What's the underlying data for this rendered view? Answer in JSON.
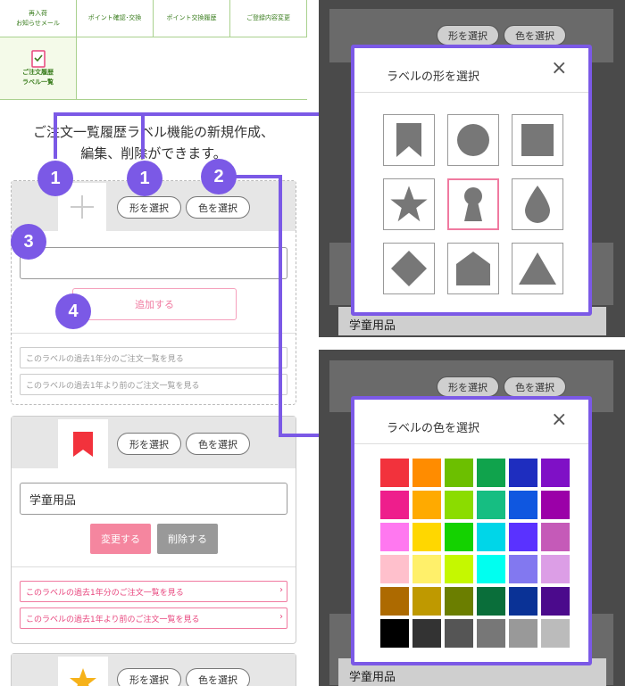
{
  "nav": {
    "top_left_line1": "再入荷",
    "top_left_line2": "お知らせメール",
    "top_cell2": "ポイント確認･交換",
    "top_cell3": "ポイント交換履歴",
    "top_cell4": "ご登録内容変更",
    "active_line1": "ご注文履歴",
    "active_line2": "ラベル一覧"
  },
  "intro": {
    "line1": "ご注文一覧履歴ラベル機能の新規作成、",
    "line2": "編集、削除ができます。"
  },
  "steps": [
    "1",
    "1",
    "2",
    "3",
    "4"
  ],
  "new_card": {
    "shape_btn": "形を選択",
    "color_btn": "色を選択",
    "add_btn": "追加する",
    "link1": "このラベルの過去1年分のご注文一覧を見る",
    "link2": "このラベルの過去1年より前のご注文一覧を見る"
  },
  "label_card": {
    "shape_btn": "形を選択",
    "color_btn": "色を選択",
    "name": "学童用品",
    "change_btn": "変更する",
    "delete_btn": "削除する",
    "link1": "このラベルの過去1年分のご注文一覧を見る",
    "link2": "このラベルの過去1年より前のご注文一覧を見る",
    "chevron": "›"
  },
  "third_card": {
    "shape_btn": "形を選択",
    "color_btn": "色を選択"
  },
  "shape_modal": {
    "title": "ラベルの形を選択",
    "close": "×",
    "bg_btn1": "形を選択",
    "bg_btn2": "色を選択",
    "bg_text": "学童用品",
    "shapes": [
      "bookmark-icon",
      "circle-icon",
      "square-icon",
      "star-icon",
      "keyhole-icon",
      "drop-icon",
      "diamond-icon",
      "house-icon",
      "triangle-icon"
    ],
    "selected_index": 4
  },
  "color_modal": {
    "title": "ラベルの色を選択",
    "close": "×",
    "bg_btn1": "形を選択",
    "bg_btn2": "色を選択",
    "bg_text": "学童用品",
    "colors": [
      "#f2323c",
      "#ff8c00",
      "#6cbf00",
      "#10a34c",
      "#1e2dbf",
      "#7f10c6",
      "#ee1e8c",
      "#ffaa00",
      "#8bdc00",
      "#16be82",
      "#0f57e0",
      "#9b00a8",
      "#ff78f0",
      "#ffd700",
      "#14d200",
      "#00d6e8",
      "#5a32ff",
      "#c55ab8",
      "#ffc0cc",
      "#fff06a",
      "#c5f800",
      "#00fff0",
      "#8278f0",
      "#dc9ee6",
      "#ad6a00",
      "#bf9900",
      "#6b7e00",
      "#0a6e3a",
      "#0a3296",
      "#4b0a8c",
      "#000000",
      "#333333",
      "#555555",
      "#777777",
      "#999999",
      "#bbbbbb"
    ]
  }
}
